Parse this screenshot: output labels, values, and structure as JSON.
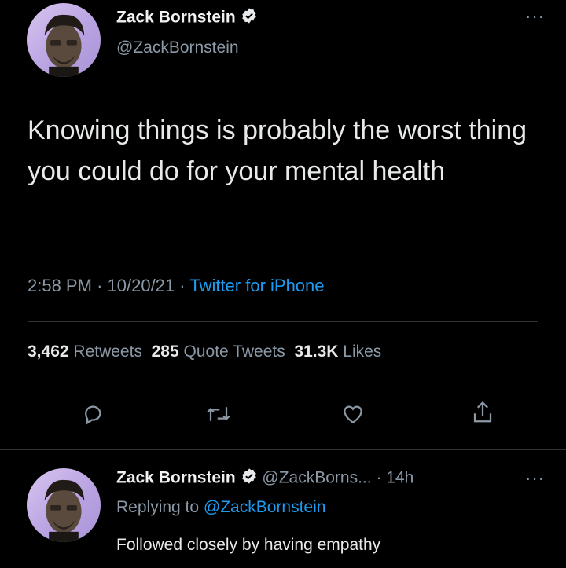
{
  "tweet": {
    "author_name": "Zack Bornstein",
    "author_handle": "@ZackBornstein",
    "text": "Knowing things is probably the worst thing you could do for your mental health",
    "time": "2:58 PM",
    "date": "10/20/21",
    "source": "Twitter for iPhone",
    "separator": "·",
    "stats": {
      "retweets_count": "3,462",
      "retweets_label": "Retweets",
      "quotes_count": "285",
      "quotes_label": "Quote Tweets",
      "likes_count": "31.3K",
      "likes_label": "Likes"
    },
    "more_glyph": "···"
  },
  "reply": {
    "author_name": "Zack Bornstein",
    "author_handle": "@ZackBorns...",
    "separator": "·",
    "age": "14h",
    "replying_prefix": "Replying to",
    "replying_to": "@ZackBornstein",
    "text": "Followed closely by having empathy",
    "more_glyph": "···"
  },
  "icons": {
    "verified": "verified-badge-icon",
    "reply": "reply-icon",
    "retweet": "retweet-icon",
    "like": "heart-icon",
    "share": "share-icon",
    "more": "more-icon"
  },
  "colors": {
    "background": "#000000",
    "accent": "#1d9bf0",
    "muted": "#8b98a5",
    "divider": "#2f3336"
  }
}
